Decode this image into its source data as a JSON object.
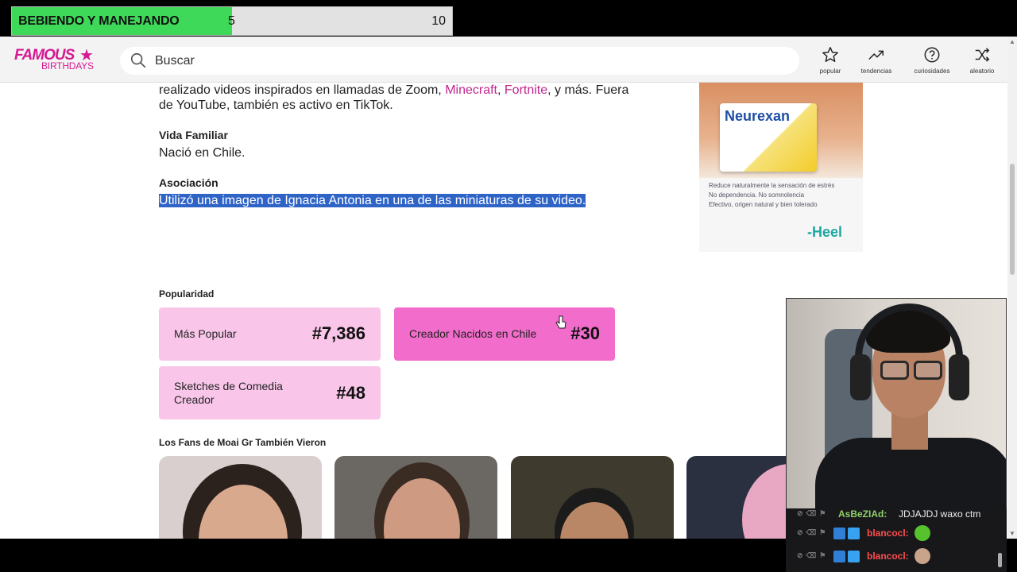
{
  "goal": {
    "label": "BEBIENDO Y MANEJANDO",
    "current": "5",
    "target": "10",
    "progress": 0.5,
    "color": "#3fd95a"
  },
  "header": {
    "logo_top": "FAMOUS",
    "logo_bottom": "BIRTHDAYS",
    "search_placeholder": "Buscar",
    "nav": [
      {
        "label": "popular",
        "icon": "star-icon"
      },
      {
        "label": "tendencias",
        "icon": "trending-icon"
      },
      {
        "label": "curiosidades",
        "icon": "question-icon"
      },
      {
        "label": "aleatorio",
        "icon": "shuffle-icon"
      }
    ]
  },
  "bio": {
    "line1_a": "realizado videos inspirados en llamadas de Zoom, ",
    "link1": "Minecraft",
    "sep": ", ",
    "link2": "Fortnite",
    "line1_b": ", y más. Fuera",
    "line2": "de YouTube, también es activo en TikTok.",
    "family_title": "Vida Familiar",
    "family_text": "Nació en Chile.",
    "assoc_title": "Asociación",
    "assoc_text": "Utilizó una imagen de Ignacia Antonia en una de las miniaturas de su video."
  },
  "ad": {
    "brand": "Neurexan",
    "bullets": [
      "Reduce naturalmente la sensación de estrés",
      "No dependencia. No somnolencia",
      "Efectivo, origen natural y bien tolerado"
    ],
    "logo": "-Heel"
  },
  "popularity": {
    "title": "Popularidad",
    "cards": [
      {
        "label": "Más Popular",
        "rank": "#7,386"
      },
      {
        "label": "Creador Nacidos en Chile",
        "rank": "#30"
      },
      {
        "label_line1": "Sketches de Comedia",
        "label_line2": "Creador",
        "rank": "#48"
      }
    ]
  },
  "fans": {
    "title": "Los Fans de Moai Gr También Vieron"
  },
  "chat": [
    {
      "user": "AsBeZIAd:",
      "message": "JDJAJDJ waxo ctm"
    },
    {
      "user": "blancocl:",
      "message": ""
    },
    {
      "user": "blancocl:",
      "message": ""
    }
  ],
  "colors": {
    "brand_pink": "#d41b93",
    "card_light": "#f9c6ea",
    "card_bright": "#f26ccb",
    "selection": "#2f64c7"
  }
}
